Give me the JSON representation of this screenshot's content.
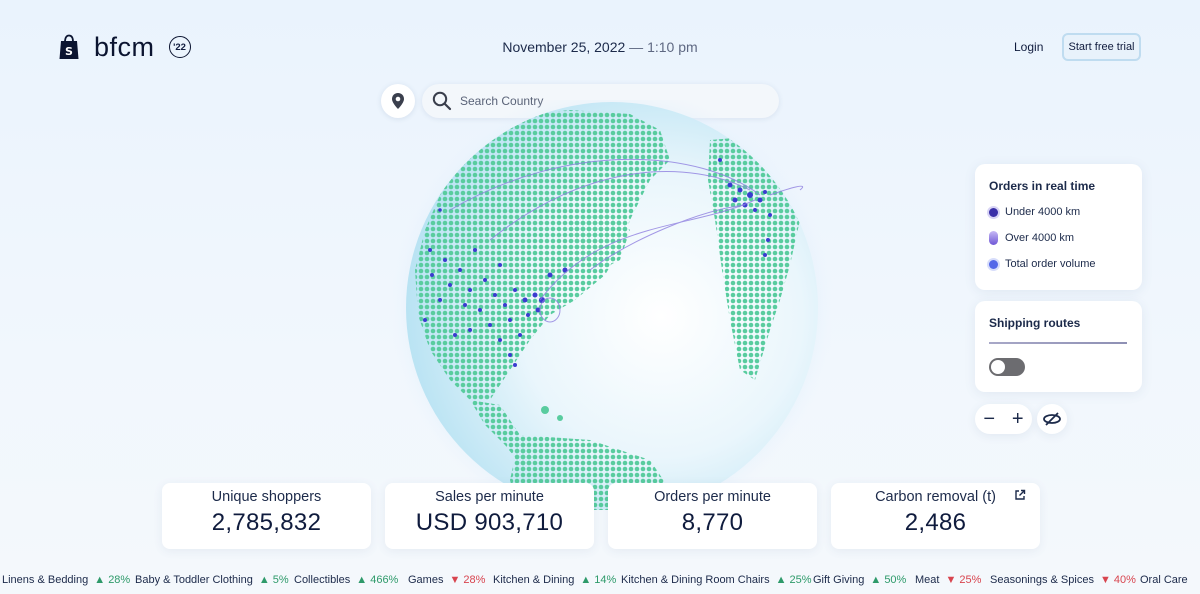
{
  "header": {
    "brand": "bfcm",
    "year_badge": "'22",
    "date": "November 25, 2022",
    "time_separator": " — ",
    "time": "1:10 pm",
    "login": "Login",
    "trial": "Start free trial"
  },
  "search": {
    "placeholder": "Search Country"
  },
  "legend": {
    "title": "Orders in real time",
    "items": [
      "Under 4000 km",
      "Over 4000 km",
      "Total order volume"
    ]
  },
  "shipping": {
    "title": "Shipping routes",
    "toggle_on": false
  },
  "zoom": {
    "minus": "−",
    "plus": "+"
  },
  "stats": [
    {
      "label": "Unique shoppers",
      "value": "2,785,832"
    },
    {
      "label": "Sales per minute",
      "value": "USD 903,710"
    },
    {
      "label": "Orders per minute",
      "value": "8,770"
    },
    {
      "label": "Carbon removal (t)",
      "value": "2,486"
    }
  ],
  "ticker": [
    {
      "name": "Linens & Bedding",
      "change": "28%",
      "dir": "up"
    },
    {
      "name": "Baby & Toddler Clothing",
      "change": "5%",
      "dir": "up"
    },
    {
      "name": "Collectibles",
      "change": "466%",
      "dir": "up"
    },
    {
      "name": "Games",
      "change": "28%",
      "dir": "down"
    },
    {
      "name": "Kitchen & Dining",
      "change": "14%",
      "dir": "up"
    },
    {
      "name": "Kitchen & Dining Room Chairs",
      "change": "25%",
      "dir": "up"
    },
    {
      "name": "Gift Giving",
      "change": "50%",
      "dir": "up"
    },
    {
      "name": "Meat",
      "change": "25%",
      "dir": "down"
    },
    {
      "name": "Seasonings & Spices",
      "change": "40%",
      "dir": "down"
    },
    {
      "name": "Oral Care",
      "change": "",
      "dir": ""
    }
  ],
  "colors": {
    "up": "#2e9a6a",
    "down": "#d8454f",
    "land": "#5fcfa3",
    "order_dot": "#3b3ccf",
    "route": "#8f7fe0"
  },
  "icons": [
    "shopify-bag-icon",
    "location-pin-icon",
    "search-icon",
    "external-link-icon",
    "rotate-globe-icon"
  ]
}
